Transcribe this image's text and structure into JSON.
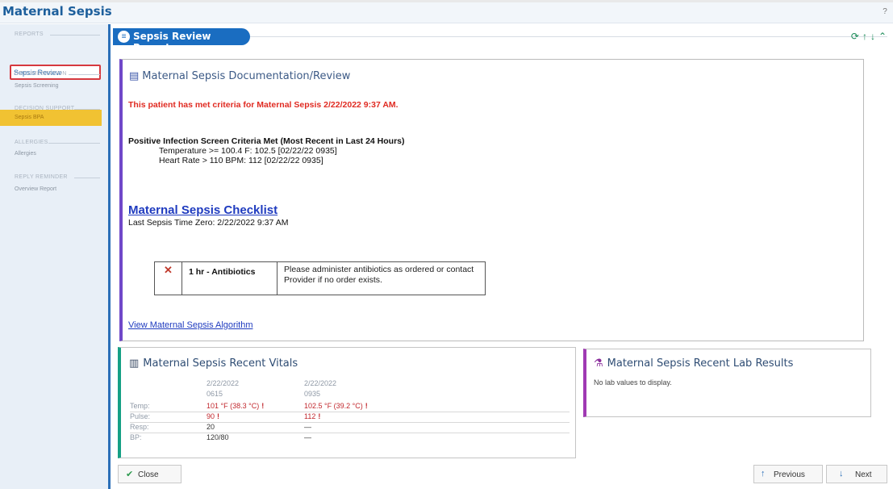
{
  "app": {
    "title": "Maternal Sepsis",
    "help_icon": "?"
  },
  "sidebar": {
    "sections": [
      {
        "heading": "REPORTS",
        "items": [
          "Sepsis Review"
        ]
      },
      {
        "heading": "DOCUMENTATION",
        "items": [
          "Sepsis Screening"
        ]
      },
      {
        "heading": "DECISION SUPPORT",
        "items": [
          "Sepsis BPA"
        ]
      },
      {
        "heading": "ALLERGIES",
        "items": [
          "Allergies"
        ]
      },
      {
        "heading": "REPLY REMINDER",
        "items": [
          "Overview Report"
        ]
      }
    ],
    "active_item": "Sepsis Review",
    "highlight_color": "#f1c232"
  },
  "report": {
    "title": "Sepsis Review Report",
    "actions": [
      "refresh-icon",
      "arrow-up-icon",
      "arrow-down-icon",
      "collapse-icon"
    ]
  },
  "documentation": {
    "title": "Maternal Sepsis Documentation/Review",
    "alert": "This patient has met criteria for Maternal Sepsis 2/22/2022  9:37 AM.",
    "screen_heading": "Positive Infection Screen Criteria Met (Most Recent in Last 24 Hours)",
    "screen_items": [
      "Temperature >= 100.4 F:  102.5 [02/22/22 0935]",
      "Heart Rate > 110 BPM:  112 [02/22/22 0935]"
    ],
    "checklist_link": "Maternal Sepsis Checklist",
    "time_zero": "Last Sepsis Time Zero: 2/22/2022  9:37 AM",
    "checklist_rows": [
      {
        "status": "✕",
        "item": "1 hr - Antibiotics",
        "instruction": "Please administer antibiotics as ordered or contact Provider if no order exists."
      }
    ],
    "algorithm_link": "View Maternal Sepsis Algorithm"
  },
  "vitals": {
    "title": "Maternal Sepsis Recent Vitals",
    "columns": [
      {
        "date": "2/22/2022",
        "time": "0615"
      },
      {
        "date": "2/22/2022",
        "time": "0935"
      }
    ],
    "rows": [
      {
        "label": "Temp:",
        "values": [
          "101 °F (38.3 °C)",
          "102.5 °F (39.2 °C)"
        ],
        "abnormal": [
          true,
          true
        ]
      },
      {
        "label": "Pulse:",
        "values": [
          "90",
          "112"
        ],
        "abnormal": [
          true,
          true
        ]
      },
      {
        "label": "Resp:",
        "values": [
          "20",
          "—"
        ],
        "abnormal": [
          false,
          false
        ]
      },
      {
        "label": "BP:",
        "values": [
          "120/80",
          "—"
        ],
        "abnormal": [
          false,
          false
        ]
      }
    ],
    "flag": "!"
  },
  "labs": {
    "title": "Maternal Sepsis Recent Lab Results",
    "empty_text": "No lab values to display."
  },
  "footer": {
    "close_label": "Close",
    "previous_label": "Previous",
    "next_label": "Next"
  }
}
